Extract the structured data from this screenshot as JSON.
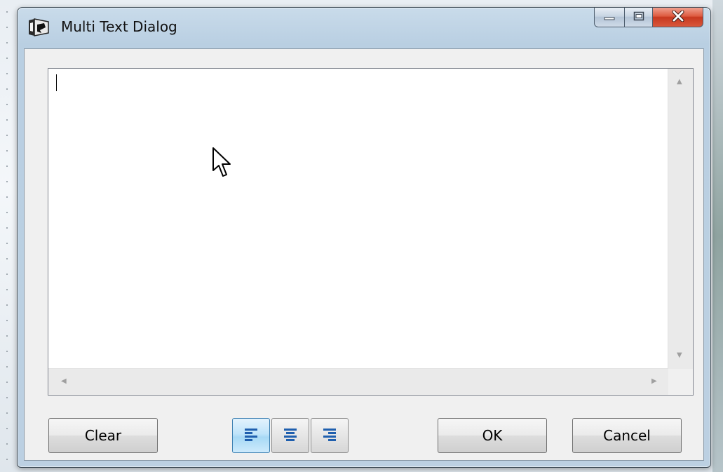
{
  "window": {
    "title": "Multi Text Dialog",
    "icon": "app-icon",
    "caption_buttons": [
      "minimize-icon",
      "maximize-icon",
      "close-icon"
    ]
  },
  "editor": {
    "value": "",
    "placeholder": "",
    "scrollbars": {
      "vertical": [
        "scroll-up-arrow-icon",
        "scroll-down-arrow-icon"
      ],
      "horizontal": [
        "scroll-left-arrow-icon",
        "scroll-right-arrow-icon"
      ]
    }
  },
  "buttons": {
    "clear_label": "Clear",
    "ok_label": "OK",
    "cancel_label": "Cancel"
  },
  "alignment": {
    "options": [
      "align-left-icon",
      "align-center-icon",
      "align-right-icon"
    ],
    "selected": "left"
  },
  "colors": {
    "accent": "#3c7fb1",
    "align_icon": "#1f5fae",
    "close_button": "#c7381f"
  }
}
